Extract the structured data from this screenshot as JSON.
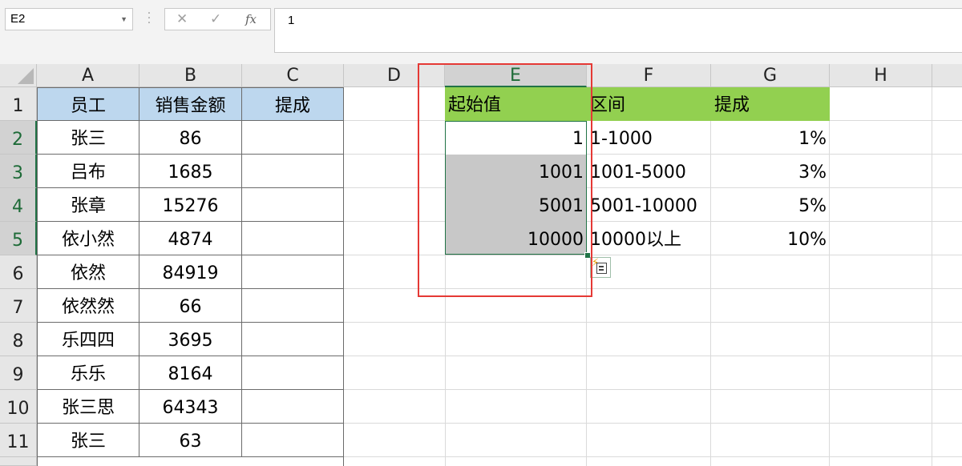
{
  "formula_bar": {
    "name_box": "E2",
    "cancel_icon": "✕",
    "enter_icon": "✓",
    "fx_label": "fx",
    "formula_value": "1"
  },
  "columns": [
    "A",
    "B",
    "C",
    "D",
    "E",
    "F",
    "G",
    "H"
  ],
  "rows": [
    "1",
    "2",
    "3",
    "4",
    "5",
    "6",
    "7",
    "8",
    "9",
    "10",
    "11"
  ],
  "employees": {
    "header": [
      "员工",
      "销售金额",
      "提成"
    ],
    "rows": [
      [
        "张三",
        "86",
        ""
      ],
      [
        "吕布",
        "1685",
        ""
      ],
      [
        "张章",
        "15276",
        ""
      ],
      [
        "依小然",
        "4874",
        ""
      ],
      [
        "依然",
        "84919",
        ""
      ],
      [
        "依然然",
        "66",
        ""
      ],
      [
        "乐四四",
        "3695",
        ""
      ],
      [
        "乐乐",
        "8164",
        ""
      ],
      [
        "张三思",
        "64343",
        ""
      ],
      [
        "张三",
        "63",
        ""
      ]
    ]
  },
  "lookup": {
    "header": [
      "起始值",
      "区间",
      "提成"
    ],
    "rows": [
      [
        "1",
        "1-1000",
        "1%"
      ],
      [
        "1001",
        "1001-5000",
        "3%"
      ],
      [
        "5001",
        "5001-10000",
        "5%"
      ],
      [
        "10000",
        "10000以上",
        "10%"
      ]
    ]
  },
  "colors": {
    "header_blue": "#BDD7EE",
    "header_green": "#92D050",
    "selection_green": "#217346",
    "highlight_red": "#E53935"
  },
  "icons": [
    "dropdown-arrow-icon",
    "cancel-icon",
    "enter-icon",
    "fx-icon",
    "quick-analysis-icon"
  ]
}
